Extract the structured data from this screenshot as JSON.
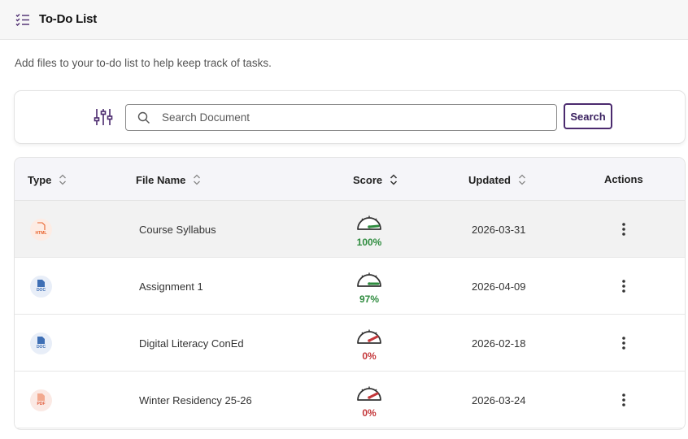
{
  "header": {
    "title": "To-Do List",
    "icon": "checklist-icon"
  },
  "subtitle": "Add files to your to-do list to help keep track of tasks.",
  "search": {
    "placeholder": "Search Document",
    "value": "",
    "button_label": "Search"
  },
  "colors": {
    "accent": "#4b2a6e",
    "good": "#2e8b3e",
    "bad": "#c4373a",
    "html": "#e8622c",
    "doc": "#3e6fb5",
    "pdf": "#e05a3a"
  },
  "table": {
    "columns": [
      "Type",
      "File Name",
      "Score",
      "Updated",
      "Actions"
    ],
    "rows": [
      {
        "type": "HTML",
        "name": "Course Syllabus",
        "score": "100%",
        "score_value": 1.0,
        "updated": "2026-03-31"
      },
      {
        "type": "DOC",
        "name": "Assignment 1",
        "score": "97%",
        "score_value": 0.97,
        "updated": "2026-04-09"
      },
      {
        "type": "DOC",
        "name": "Digital Literacy ConEd",
        "score": "0%",
        "score_value": 0.0,
        "updated": "2026-02-18"
      },
      {
        "type": "PDF",
        "name": "Winter Residency 25-26",
        "score": "0%",
        "score_value": 0.0,
        "updated": "2026-03-24"
      }
    ]
  }
}
